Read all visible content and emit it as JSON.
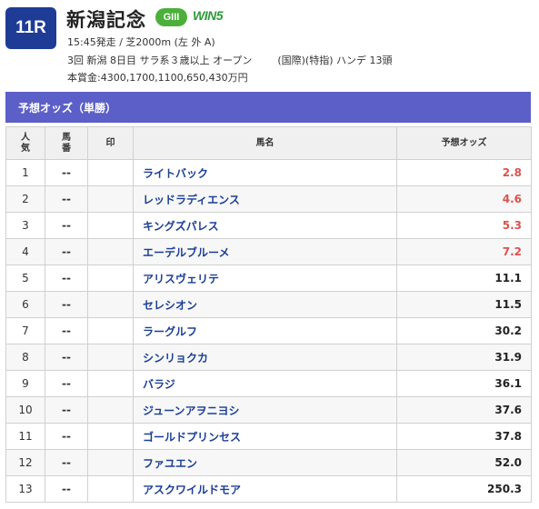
{
  "race": {
    "number": "11R",
    "name": "新潟記念",
    "grade": "GIII",
    "win5": "WIN5",
    "info_line1": "15:45発走 / 芝2000m (左 外 A)",
    "info_line2": "3回 新潟 8日目 サラ系３歳以上 オープン",
    "info_line2_tags": "(国際)(特指) ハンデ 13頭",
    "prize": "本賞金:4300,1700,1100,650,430万円"
  },
  "section_title": "予想オッズ（単勝）",
  "table": {
    "headers": {
      "rank": "人気",
      "num": "馬番",
      "mark": "印",
      "name": "馬名",
      "odds": "予想オッズ"
    },
    "rows": [
      {
        "rank": "1",
        "num": "--",
        "name": "ライトバック",
        "odds": "2.8",
        "highlight": true
      },
      {
        "rank": "2",
        "num": "--",
        "name": "レッドラディエンス",
        "odds": "4.6",
        "highlight": true
      },
      {
        "rank": "3",
        "num": "--",
        "name": "キングズパレス",
        "odds": "5.3",
        "highlight": true
      },
      {
        "rank": "4",
        "num": "--",
        "name": "エーデルブルーメ",
        "odds": "7.2",
        "highlight": true
      },
      {
        "rank": "5",
        "num": "--",
        "name": "アリスヴェリテ",
        "odds": "11.1",
        "highlight": false
      },
      {
        "rank": "6",
        "num": "--",
        "name": "セレシオン",
        "odds": "11.5",
        "highlight": false
      },
      {
        "rank": "7",
        "num": "--",
        "name": "ラーグルフ",
        "odds": "30.2",
        "highlight": false
      },
      {
        "rank": "8",
        "num": "--",
        "name": "シンリョクカ",
        "odds": "31.9",
        "highlight": false
      },
      {
        "rank": "9",
        "num": "--",
        "name": "バラジ",
        "odds": "36.1",
        "highlight": false
      },
      {
        "rank": "10",
        "num": "--",
        "name": "ジューンアヲニヨシ",
        "odds": "37.6",
        "highlight": false
      },
      {
        "rank": "11",
        "num": "--",
        "name": "ゴールドプリンセス",
        "odds": "37.8",
        "highlight": false
      },
      {
        "rank": "12",
        "num": "--",
        "name": "ファユエン",
        "odds": "52.0",
        "highlight": false
      },
      {
        "rank": "13",
        "num": "--",
        "name": "アスクワイルドモア",
        "odds": "250.3",
        "highlight": false
      }
    ]
  },
  "colors": {
    "race_badge": "#1e3c96",
    "grade_badge": "#4caf3a",
    "section_bar": "#5b5fc7",
    "horse_link": "#1a3e96",
    "odds_favorite": "#d9534f",
    "odds_normal": "#222222"
  }
}
